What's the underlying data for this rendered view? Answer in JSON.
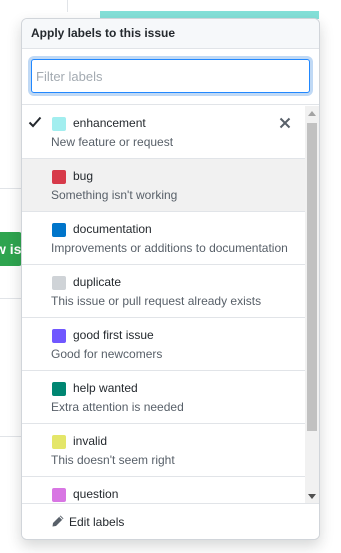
{
  "background": {
    "partial_button_label": "w is"
  },
  "popup": {
    "title": "Apply labels to this issue",
    "filter": {
      "placeholder": "Filter labels",
      "value": ""
    },
    "labels": [
      {
        "name": "enhancement",
        "description": "New feature or request",
        "color": "#a2eeef",
        "selected": true
      },
      {
        "name": "bug",
        "description": "Something isn't working",
        "color": "#d73a4a",
        "selected": false
      },
      {
        "name": "documentation",
        "description": "Improvements or additions to documentation",
        "color": "#0075ca",
        "selected": false
      },
      {
        "name": "duplicate",
        "description": "This issue or pull request already exists",
        "color": "#cfd3d7",
        "selected": false
      },
      {
        "name": "good first issue",
        "description": "Good for newcomers",
        "color": "#7057ff",
        "selected": false
      },
      {
        "name": "help wanted",
        "description": "Extra attention is needed",
        "color": "#008672",
        "selected": false
      },
      {
        "name": "invalid",
        "description": "This doesn't seem right",
        "color": "#e4e669",
        "selected": false
      },
      {
        "name": "question",
        "description": "",
        "color": "#d876e3",
        "selected": false
      }
    ],
    "footer": {
      "edit_label": "Edit labels",
      "icon": "pencil-icon"
    }
  },
  "colors": {
    "accent_focus": "#2188ff",
    "teal_bar": "#84e0d8",
    "green_button": "#2ea44f"
  }
}
